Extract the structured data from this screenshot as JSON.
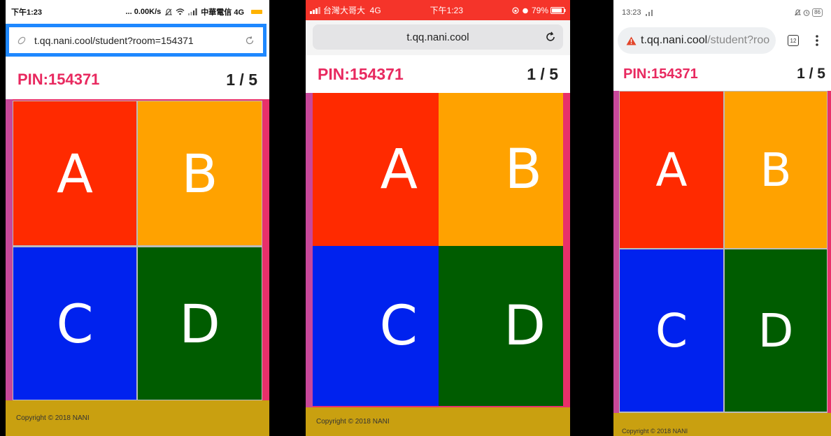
{
  "phones": [
    {
      "status": {
        "time": "下午1:23",
        "right": "... 0.00K/s",
        "carrier": "中華電信 4G"
      },
      "url": "t.qq.nani.cool/student?room=154371",
      "pin": "PIN:154371",
      "counter": "1 / 5",
      "footer": "Copyright © 2018 NANI"
    },
    {
      "status": {
        "carrier": "台灣大哥大  4G",
        "time": "下午1:23",
        "battery": "79%"
      },
      "url": "t.qq.nani.cool",
      "pin": "PIN:154371",
      "counter": "1 / 5",
      "footer": "Copyright © 2018 NANI"
    },
    {
      "status": {
        "time": "13:23",
        "battery": "86"
      },
      "url_host": "t.qq.nani.cool",
      "url_path": "/student?roo",
      "tab_count": "12",
      "pin": "PIN:154371",
      "counter": "1 / 5",
      "footer": "Copyright © 2018 NANI"
    }
  ],
  "answers": [
    {
      "label": "A",
      "color": "#ff2a00"
    },
    {
      "label": "B",
      "color": "#ffa200"
    },
    {
      "label": "C",
      "color": "#0022ee"
    },
    {
      "label": "D",
      "color": "#005c00"
    }
  ],
  "colors": {
    "pin": "#e8295f",
    "side": "#e8306a",
    "footer": "#c9a010",
    "highlight": "#1e88ff"
  }
}
